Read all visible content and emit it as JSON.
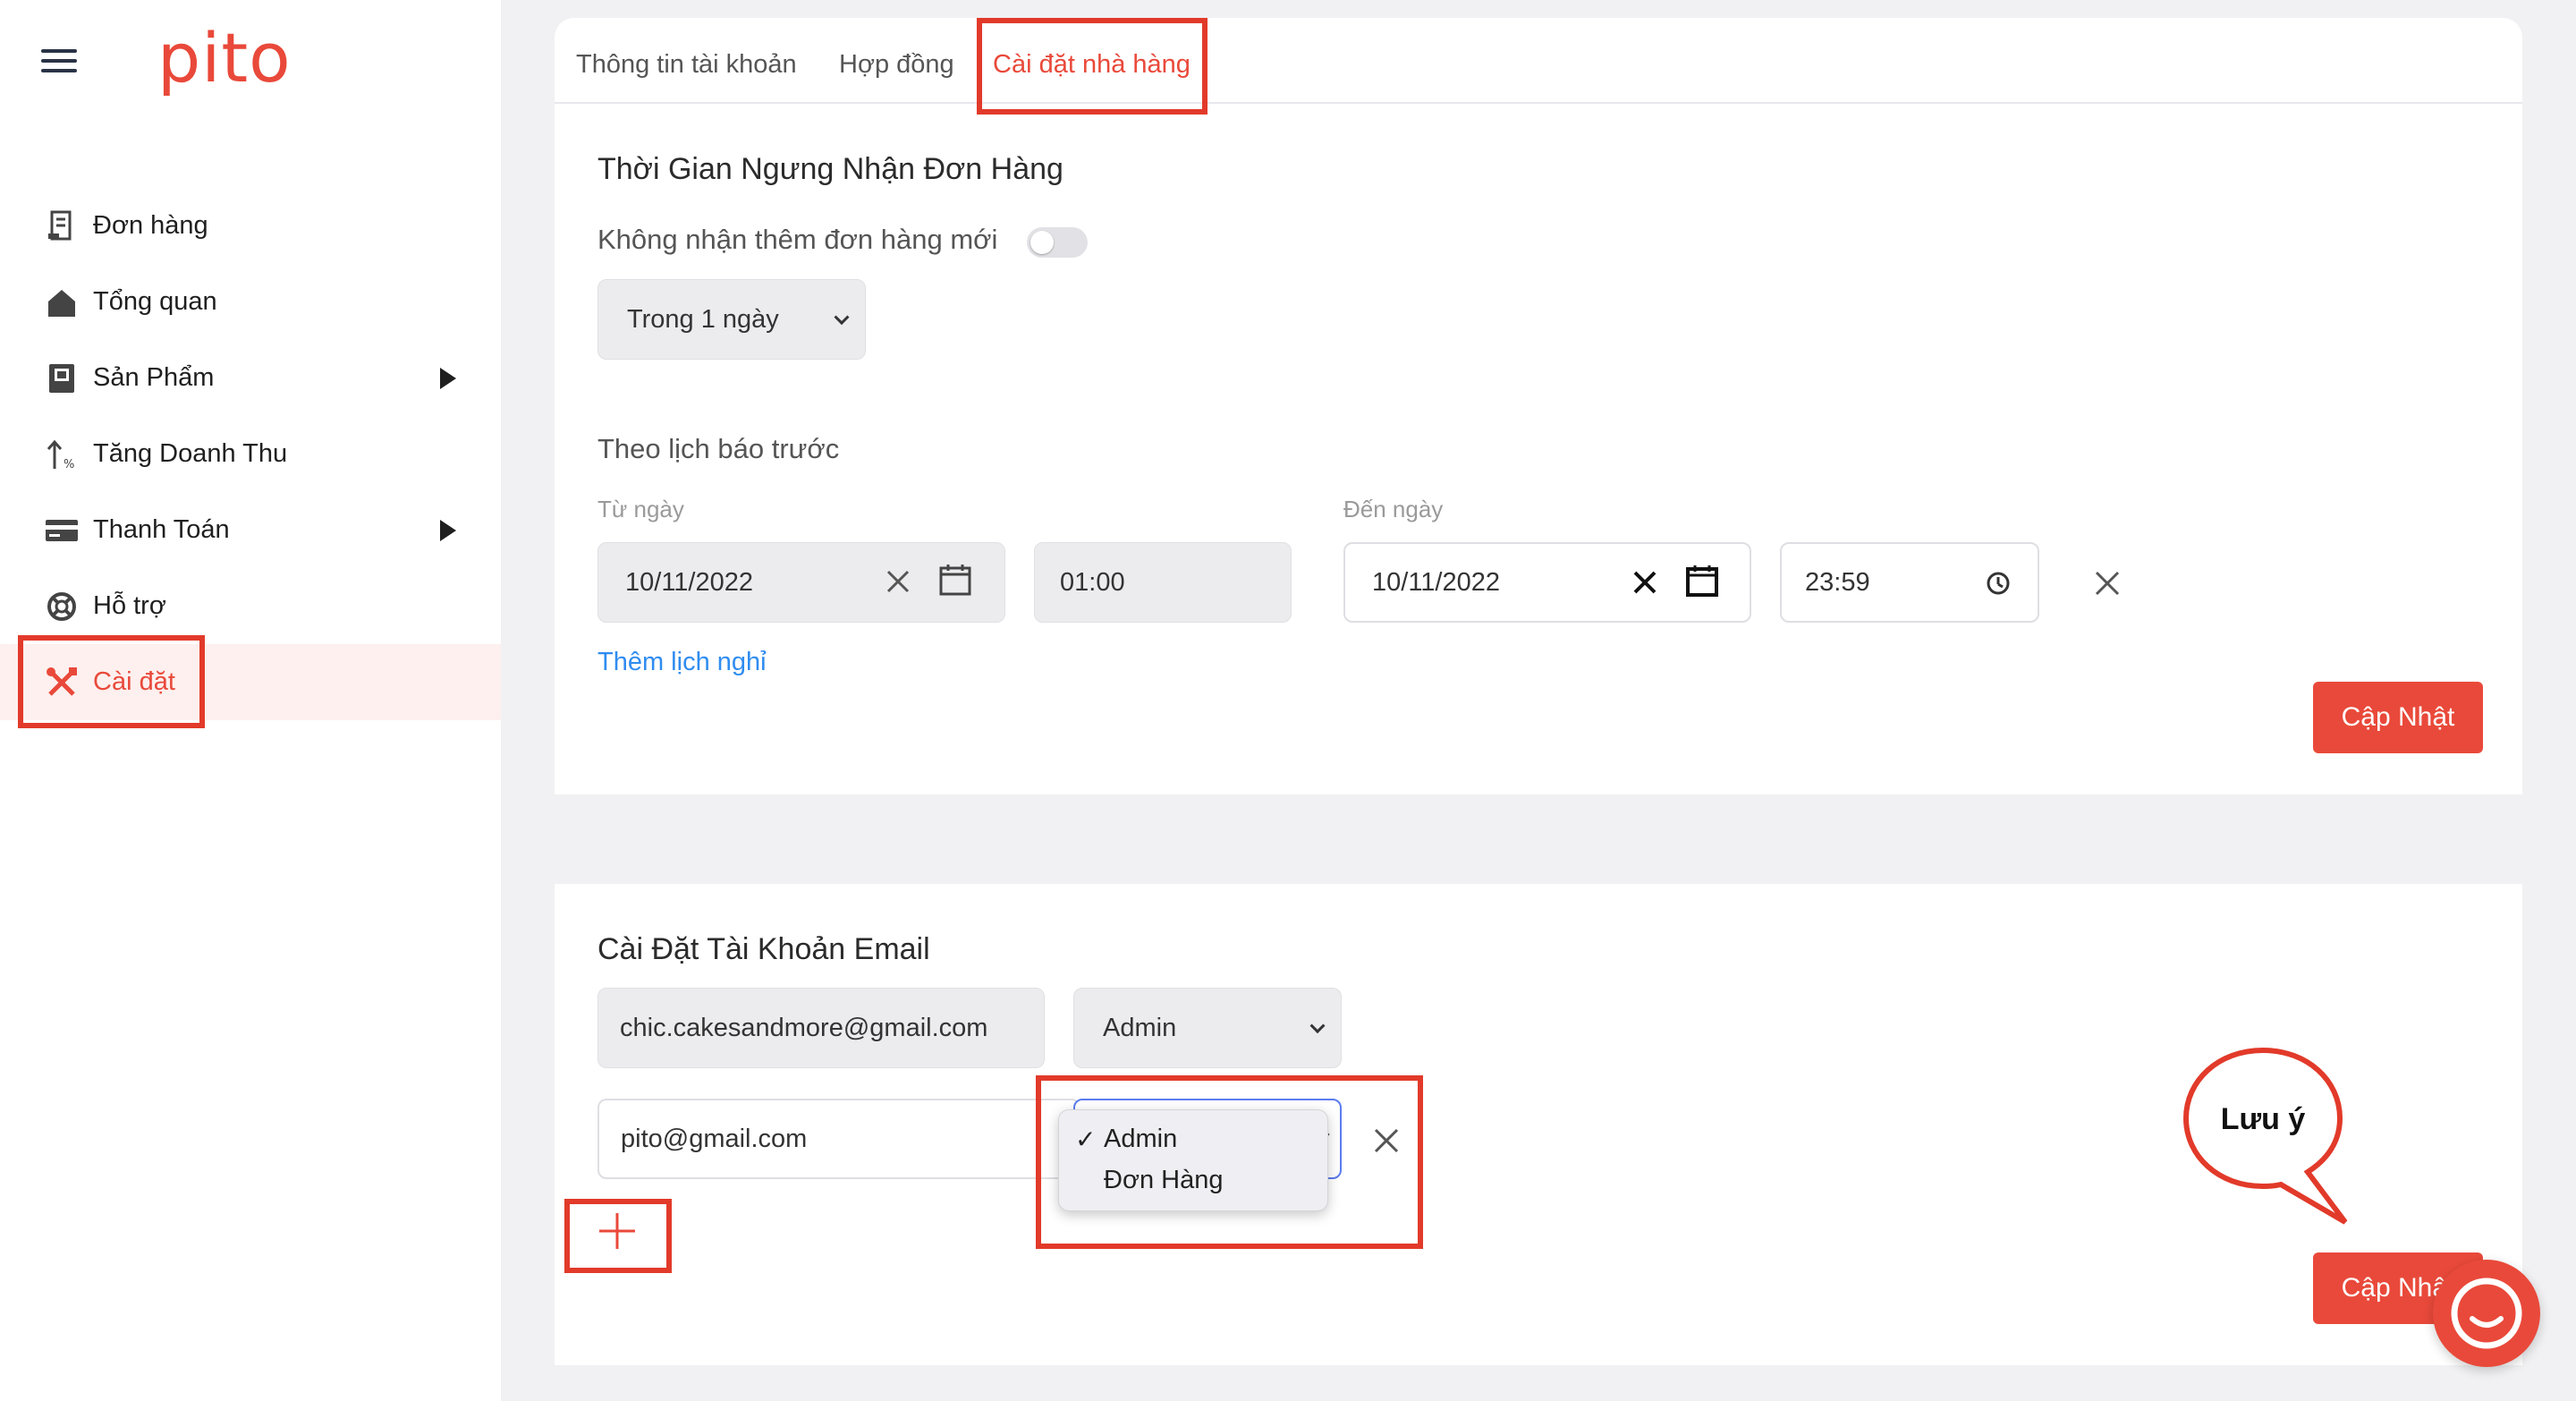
{
  "brand": {
    "logo": "pito",
    "accent": "#e9493a"
  },
  "sidebar": {
    "items": [
      {
        "label": "Đơn hàng",
        "icon": "receipt-icon"
      },
      {
        "label": "Tổng quan",
        "icon": "home-icon"
      },
      {
        "label": "Sản Phẩm",
        "icon": "book-icon",
        "has_submenu": true
      },
      {
        "label": "Tăng Doanh Thu",
        "icon": "trend-up-icon"
      },
      {
        "label": "Thanh Toán",
        "icon": "card-icon",
        "has_submenu": true
      },
      {
        "label": "Hỗ trợ",
        "icon": "lifebuoy-icon"
      },
      {
        "label": "Cài đặt",
        "icon": "tools-icon",
        "active": true
      }
    ]
  },
  "tabs": [
    {
      "label": "Thông tin tài khoản"
    },
    {
      "label": "Hợp đồng"
    },
    {
      "label": "Cài đặt nhà hàng",
      "active": true
    }
  ],
  "pause": {
    "title": "Thời Gian Ngưng Nhận Đơn Hàng",
    "toggle_label": "Không nhận thêm đơn hàng mới",
    "toggle_on": false,
    "duration_select": "Trong 1 ngày",
    "schedule_title": "Theo lịch báo trước",
    "from_label": "Từ ngày",
    "to_label": "Đến ngày",
    "from_date": "10/11/2022",
    "from_time": "01:00",
    "to_date": "10/11/2022",
    "to_time": "23:59",
    "add_link": "Thêm lịch nghỉ",
    "update_button": "Cập Nhật"
  },
  "email": {
    "title": "Cài Đặt Tài Khoản Email",
    "rows": [
      {
        "email": "chic.cakesandmore@gmail.com",
        "role": "Admin"
      },
      {
        "email": "pito@gmail.com",
        "role": "Admin"
      }
    ],
    "role_options": [
      "Admin",
      "Đơn Hàng"
    ],
    "update_button": "Cập Nhật",
    "note_bubble": "Lưu ý"
  }
}
